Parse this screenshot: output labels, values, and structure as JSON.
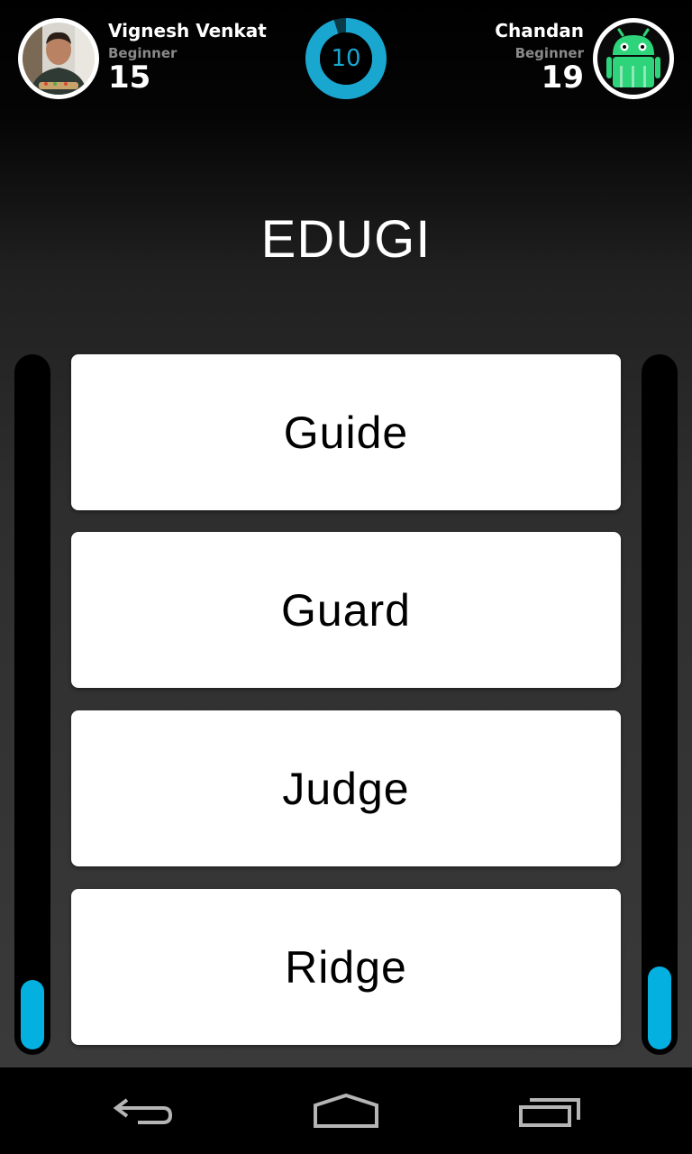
{
  "app": {
    "title": "EDUGI"
  },
  "timer": {
    "value": "10",
    "remaining_fraction": 0.95,
    "color": "#1aa7cf"
  },
  "player_left": {
    "name": "Vignesh Venkat",
    "level": "Beginner",
    "score": "15",
    "avatar_icon": "user-photo",
    "progress_fraction": 0.1
  },
  "player_right": {
    "name": "Chandan",
    "level": "Beginner",
    "score": "19",
    "avatar_icon": "android-robot-icon",
    "progress_fraction": 0.12
  },
  "options": [
    {
      "label": "Guide"
    },
    {
      "label": "Guard"
    },
    {
      "label": "Judge"
    },
    {
      "label": "Ridge"
    }
  ],
  "colors": {
    "accent": "#03b0e0",
    "android_green": "#2ed47a"
  },
  "navbar": {
    "back_icon": "back-icon",
    "home_icon": "home-icon",
    "recents_icon": "recents-icon"
  }
}
